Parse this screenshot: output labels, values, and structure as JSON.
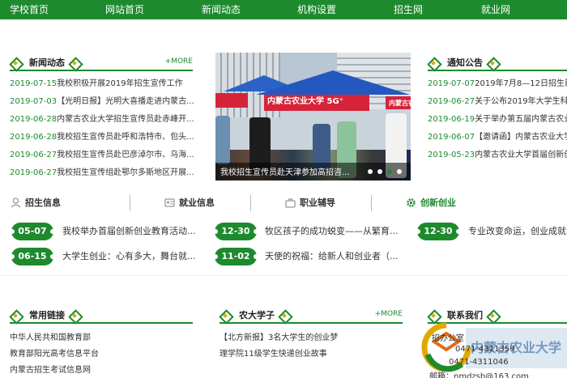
{
  "nav": [
    "学校首页",
    "网站首页",
    "新闻动态",
    "机构设置",
    "招生网",
    "就业网"
  ],
  "news": {
    "title": "新闻动态",
    "more": "+MORE",
    "items": [
      {
        "date": "2019-07-15",
        "text": "我校积极开展2019年招生宣传工作"
      },
      {
        "date": "2019-07-03",
        "text": "【光明日报】光明大喜播走进内蒙古..."
      },
      {
        "date": "2019-06-28",
        "text": "内蒙古农业大学招生宣传员赴赤峰开..."
      },
      {
        "date": "2019-06-28",
        "text": "我校招生宣传员赴呼和浩特市、包头..."
      },
      {
        "date": "2019-06-27",
        "text": "我校招生宣传员赴巴彦淖尔市、乌海..."
      },
      {
        "date": "2019-06-27",
        "text": "我校招生宣传组赴鄂尔多斯地区开展..."
      }
    ]
  },
  "carousel": {
    "banner_text": "内蒙古农业大学 5G⁺",
    "banner_text_2": "内蒙古农",
    "caption": "我校招生宣传员赴天津参加高招咨..."
  },
  "notice": {
    "title": "通知公告",
    "items": [
      {
        "date": "2019-07-07",
        "text": "2019年7月8—12日招生就"
      },
      {
        "date": "2019-06-27",
        "text": "关于公布2019年大学生科技"
      },
      {
        "date": "2019-06-19",
        "text": "关于举办第五届内蒙古农业"
      },
      {
        "date": "2019-06-07",
        "text": "【邀请函】内蒙古农业大学"
      },
      {
        "date": "2019-05-23",
        "text": "内蒙古农业大学首届创新创"
      }
    ]
  },
  "tabs": [
    {
      "label": "招生信息",
      "icon": "person-icon"
    },
    {
      "label": "就业信息",
      "icon": "id-card-icon"
    },
    {
      "label": "职业辅导",
      "icon": "briefcase-icon"
    },
    {
      "label": "创新创业",
      "icon": "gear-icon"
    }
  ],
  "tab_articles": [
    {
      "date": "05-07",
      "text": "我校举办首届创新创业教育活动..."
    },
    {
      "date": "12-30",
      "text": "牧区孩子的成功蜕变——从繁育..."
    },
    {
      "date": "12-30",
      "text": "专业改变命运，创业成就"
    },
    {
      "date": "06-15",
      "text": "大学生创业：心有多大，舞台就..."
    },
    {
      "date": "11-02",
      "text": "天使的祝福：给新人和创业者（..."
    }
  ],
  "links": {
    "title": "常用链接",
    "items": [
      "中华人民共和国教育部",
      "教育部阳光高考信息平台",
      "内蒙古招生考试信息网"
    ]
  },
  "students": {
    "title": "农大学子",
    "more": "+MORE",
    "items": [
      "【北方新报】3名大学生的创业梦",
      "理学院11级学生快递创业故事"
    ]
  },
  "contact": {
    "title": "联系我们",
    "office": "招办公室",
    "phone1": "0471-4311359",
    "phone2": "0471-4311046",
    "email": "邮箱：nmdzsb@163.com",
    "watermark": "内蒙古农业大学"
  },
  "colors": {
    "brand_green": "#1e8a2e",
    "accent_gold": "#e0a800",
    "banner_red": "#d5243a"
  }
}
